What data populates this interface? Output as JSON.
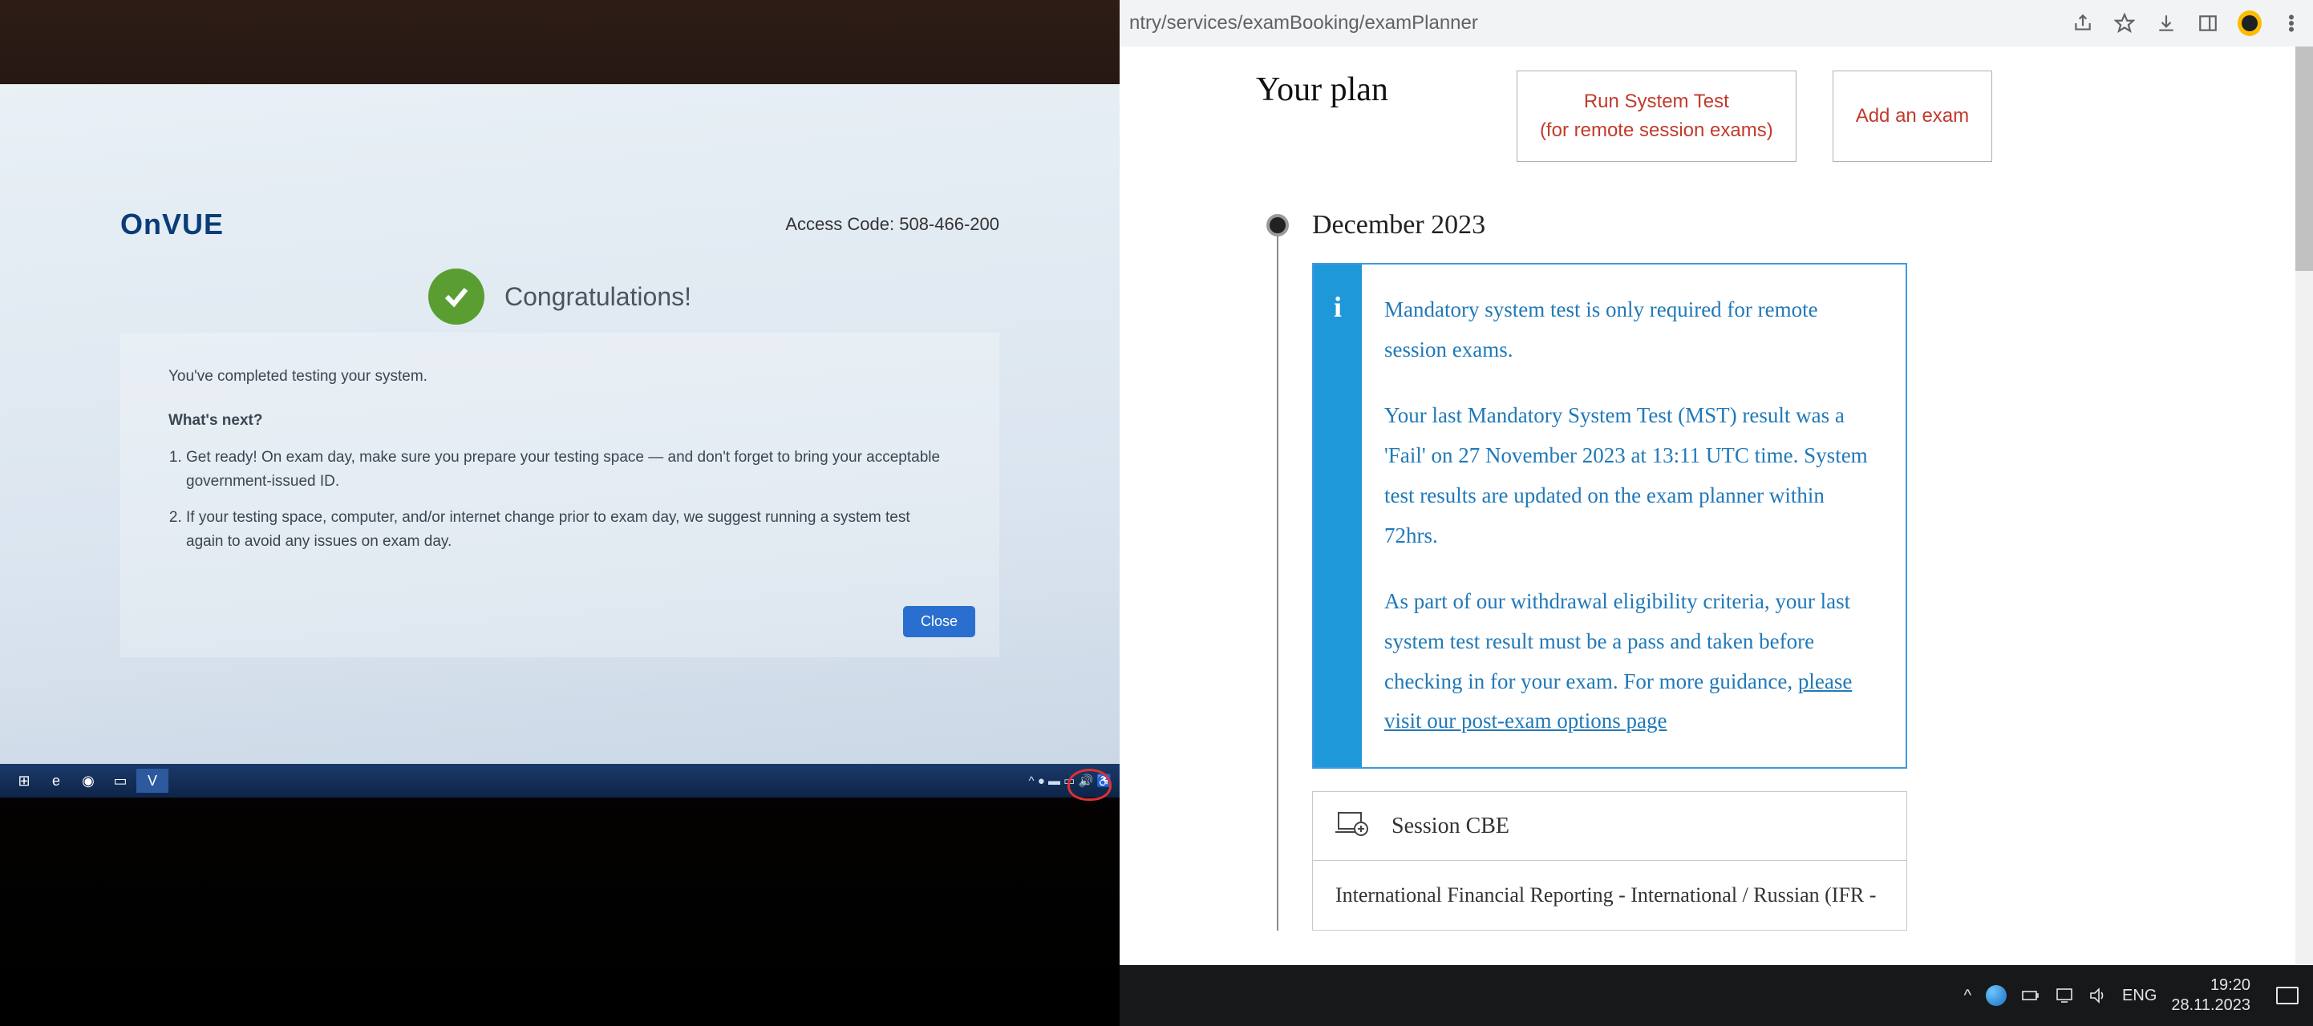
{
  "left": {
    "logo": "OnVUE",
    "access_code_label": "Access Code:",
    "access_code_value": "508-466-200",
    "congrats": "Congratulations!",
    "completed_line": "You've completed testing your system.",
    "whats_next": "What's next?",
    "step1": "Get ready! On exam day, make sure you prepare your testing space — and don't forget to bring your acceptable government-issued ID.",
    "step2": "If your testing space, computer, and/or internet change prior to exam day, we suggest running a system test again to avoid any issues on exam day.",
    "close_btn": "Close"
  },
  "chrome": {
    "url_fragment": "ntry/services/examBooking/examPlanner"
  },
  "plan": {
    "title": "Your plan",
    "run_test_l1": "Run System Test",
    "run_test_l2": "(for remote session exams)",
    "add_exam": "Add an exam"
  },
  "timeline": {
    "month": "December 2023",
    "info_p1": "Mandatory system test is only required for remote session exams.",
    "info_p2": "Your last Mandatory System Test (MST) result was a 'Fail' on 27 November 2023 at 13:11 UTC time. System test results are updated on the exam planner within 72hrs.",
    "info_p3_a": "As part of our withdrawal eligibility criteria, your last system test result must be a pass and taken before checking in for your exam. For more guidance, ",
    "info_p3_link": "please visit our post-exam options page",
    "session_title": "Session CBE",
    "session_exam": "International Financial Reporting - International / Russian (IFR -"
  },
  "taskbar": {
    "lang": "ENG",
    "time": "19:20",
    "date": "28.11.2023"
  }
}
